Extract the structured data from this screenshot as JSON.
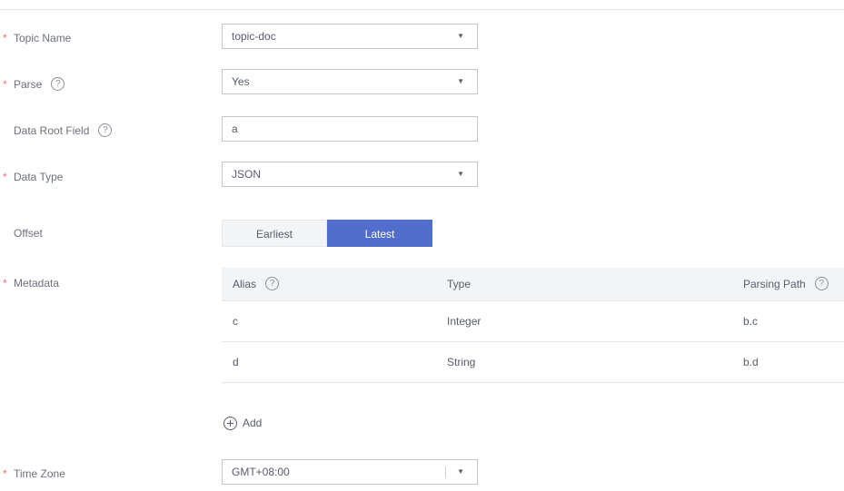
{
  "form": {
    "topic_name": {
      "label": "Topic Name",
      "required": "*",
      "value": "topic-doc"
    },
    "parse": {
      "label": "Parse",
      "required": "*",
      "value": "Yes"
    },
    "data_root_field": {
      "label": "Data Root Field",
      "value": "a"
    },
    "data_type": {
      "label": "Data Type",
      "required": "*",
      "value": "JSON"
    },
    "offset": {
      "label": "Offset",
      "options": [
        "Earliest",
        "Latest"
      ],
      "selected": "Latest"
    },
    "metadata": {
      "label": "Metadata",
      "required": "*",
      "columns": [
        "Alias",
        "Type",
        "Parsing Path"
      ],
      "rows": [
        {
          "alias": "c",
          "type": "Integer",
          "path": "b.c"
        },
        {
          "alias": "d",
          "type": "String",
          "path": "b.d"
        }
      ],
      "add_label": "Add"
    },
    "time_zone": {
      "label": "Time Zone",
      "required": "*",
      "value": "GMT+08:00"
    }
  },
  "icons": {
    "help": "?",
    "caret": "▼"
  },
  "colors": {
    "accent": "#526ecc",
    "required": "#f66f6a"
  }
}
